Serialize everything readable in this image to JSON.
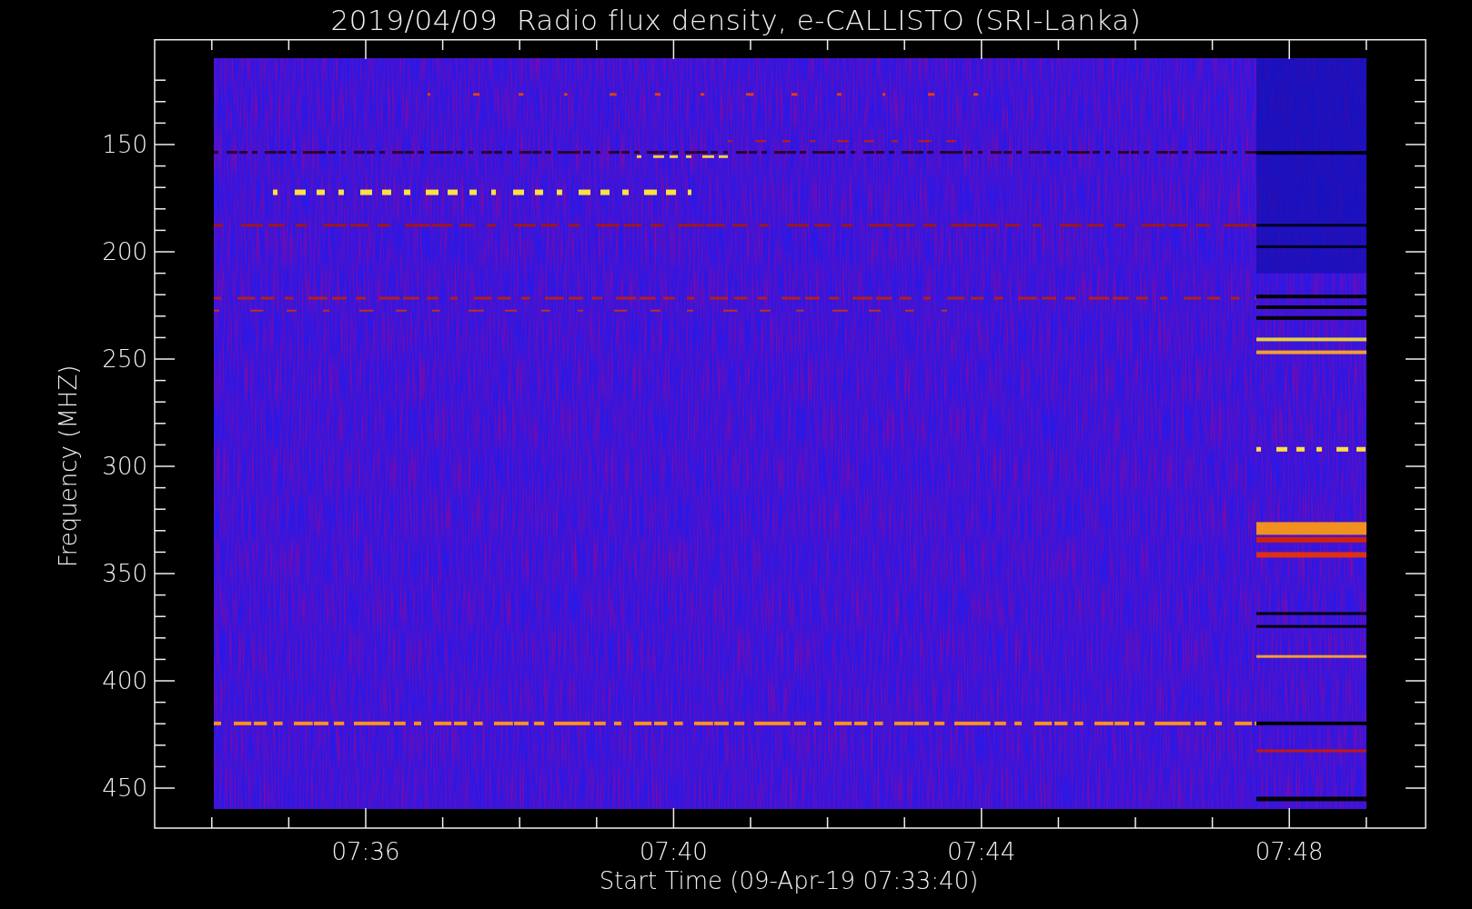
{
  "title": "2019/04/09  Radio flux density, e-CALLISTO (SRI-Lanka)",
  "y_axis": {
    "label": "Frequency (MHZ)",
    "ticks": [
      "150",
      "200",
      "250",
      "300",
      "350",
      "400",
      "450"
    ]
  },
  "x_axis": {
    "label": "Start Time (09-Apr-19 07:33:40)",
    "ticks": [
      "07:36",
      "07:40",
      "07:44",
      "07:48"
    ]
  }
}
